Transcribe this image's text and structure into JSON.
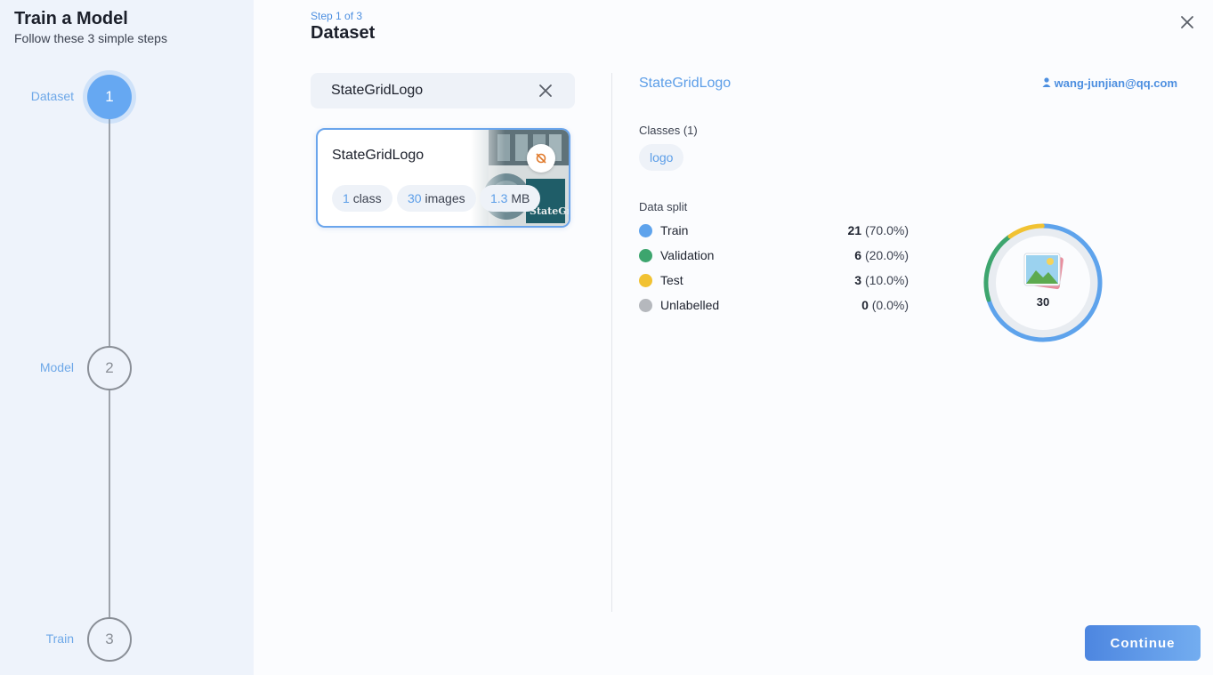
{
  "sidebar": {
    "title": "Train a Model",
    "subtitle": "Follow these 3 simple steps",
    "steps": [
      {
        "label": "Dataset",
        "number": "1",
        "state": "active"
      },
      {
        "label": "Model",
        "number": "2",
        "state": "idle"
      },
      {
        "label": "Train",
        "number": "3",
        "state": "idle"
      }
    ]
  },
  "header": {
    "step_count": "Step 1 of 3",
    "title": "Dataset",
    "close_icon": "close-icon"
  },
  "search": {
    "value": "StateGridLogo",
    "clear_icon": "clear-icon"
  },
  "dataset_card": {
    "name": "StateGridLogo",
    "class_count": "1",
    "class_unit": "class",
    "image_count": "30",
    "image_unit": "images",
    "size_value": "1.3",
    "size_unit": "MB",
    "hide_icon": "visibility-off-icon"
  },
  "details": {
    "name": "StateGridLogo",
    "owner": "wang-junjian@qq.com",
    "owner_icon": "person-icon",
    "classes_label": "Classes (1)",
    "classes": [
      "logo"
    ],
    "split_label": "Data split",
    "split": [
      {
        "name": "Train",
        "count": "21",
        "pct": "(70.0%)",
        "fraction": 0.7,
        "color": "#5ea3ec"
      },
      {
        "name": "Validation",
        "count": "6",
        "pct": "(20.0%)",
        "fraction": 0.2,
        "color": "#3da56e"
      },
      {
        "name": "Test",
        "count": "3",
        "pct": "(10.0%)",
        "fraction": 0.1,
        "color": "#f1c232"
      },
      {
        "name": "Unlabelled",
        "count": "0",
        "pct": "(0.0%)",
        "fraction": 0.0,
        "color": "#b5b8bd"
      }
    ],
    "total": "30",
    "donut_icon": "image-gallery-icon"
  },
  "continue_label": "Continue"
}
